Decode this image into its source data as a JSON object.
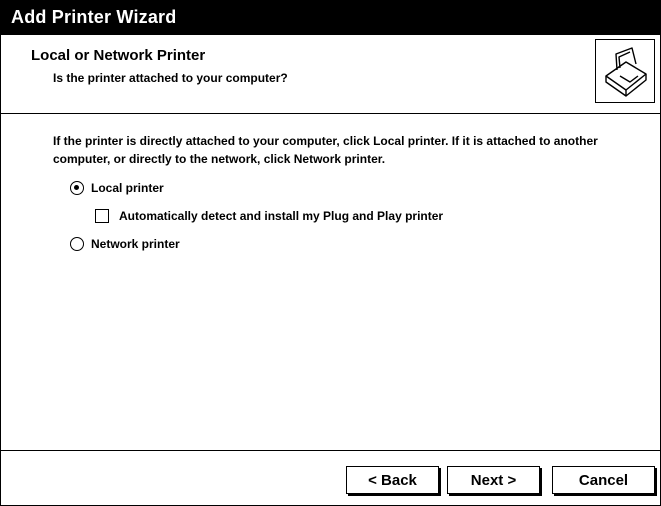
{
  "window": {
    "title": "Add Printer Wizard"
  },
  "header": {
    "heading": "Local or Network Printer",
    "subheading": "Is the printer attached to your computer?",
    "icon": "printer-icon"
  },
  "content": {
    "intro": "If the printer is directly attached to your computer, click Local printer. If it is attached to another computer, or directly to the network, click Network printer.",
    "options": {
      "local": {
        "label": "Local printer",
        "selected": true
      },
      "auto_detect": {
        "label": "Automatically detect and install my Plug and Play printer",
        "checked": false
      },
      "network": {
        "label": "Network printer",
        "selected": false
      }
    }
  },
  "buttons": {
    "back": "< Back",
    "next": "Next >",
    "cancel": "Cancel"
  }
}
